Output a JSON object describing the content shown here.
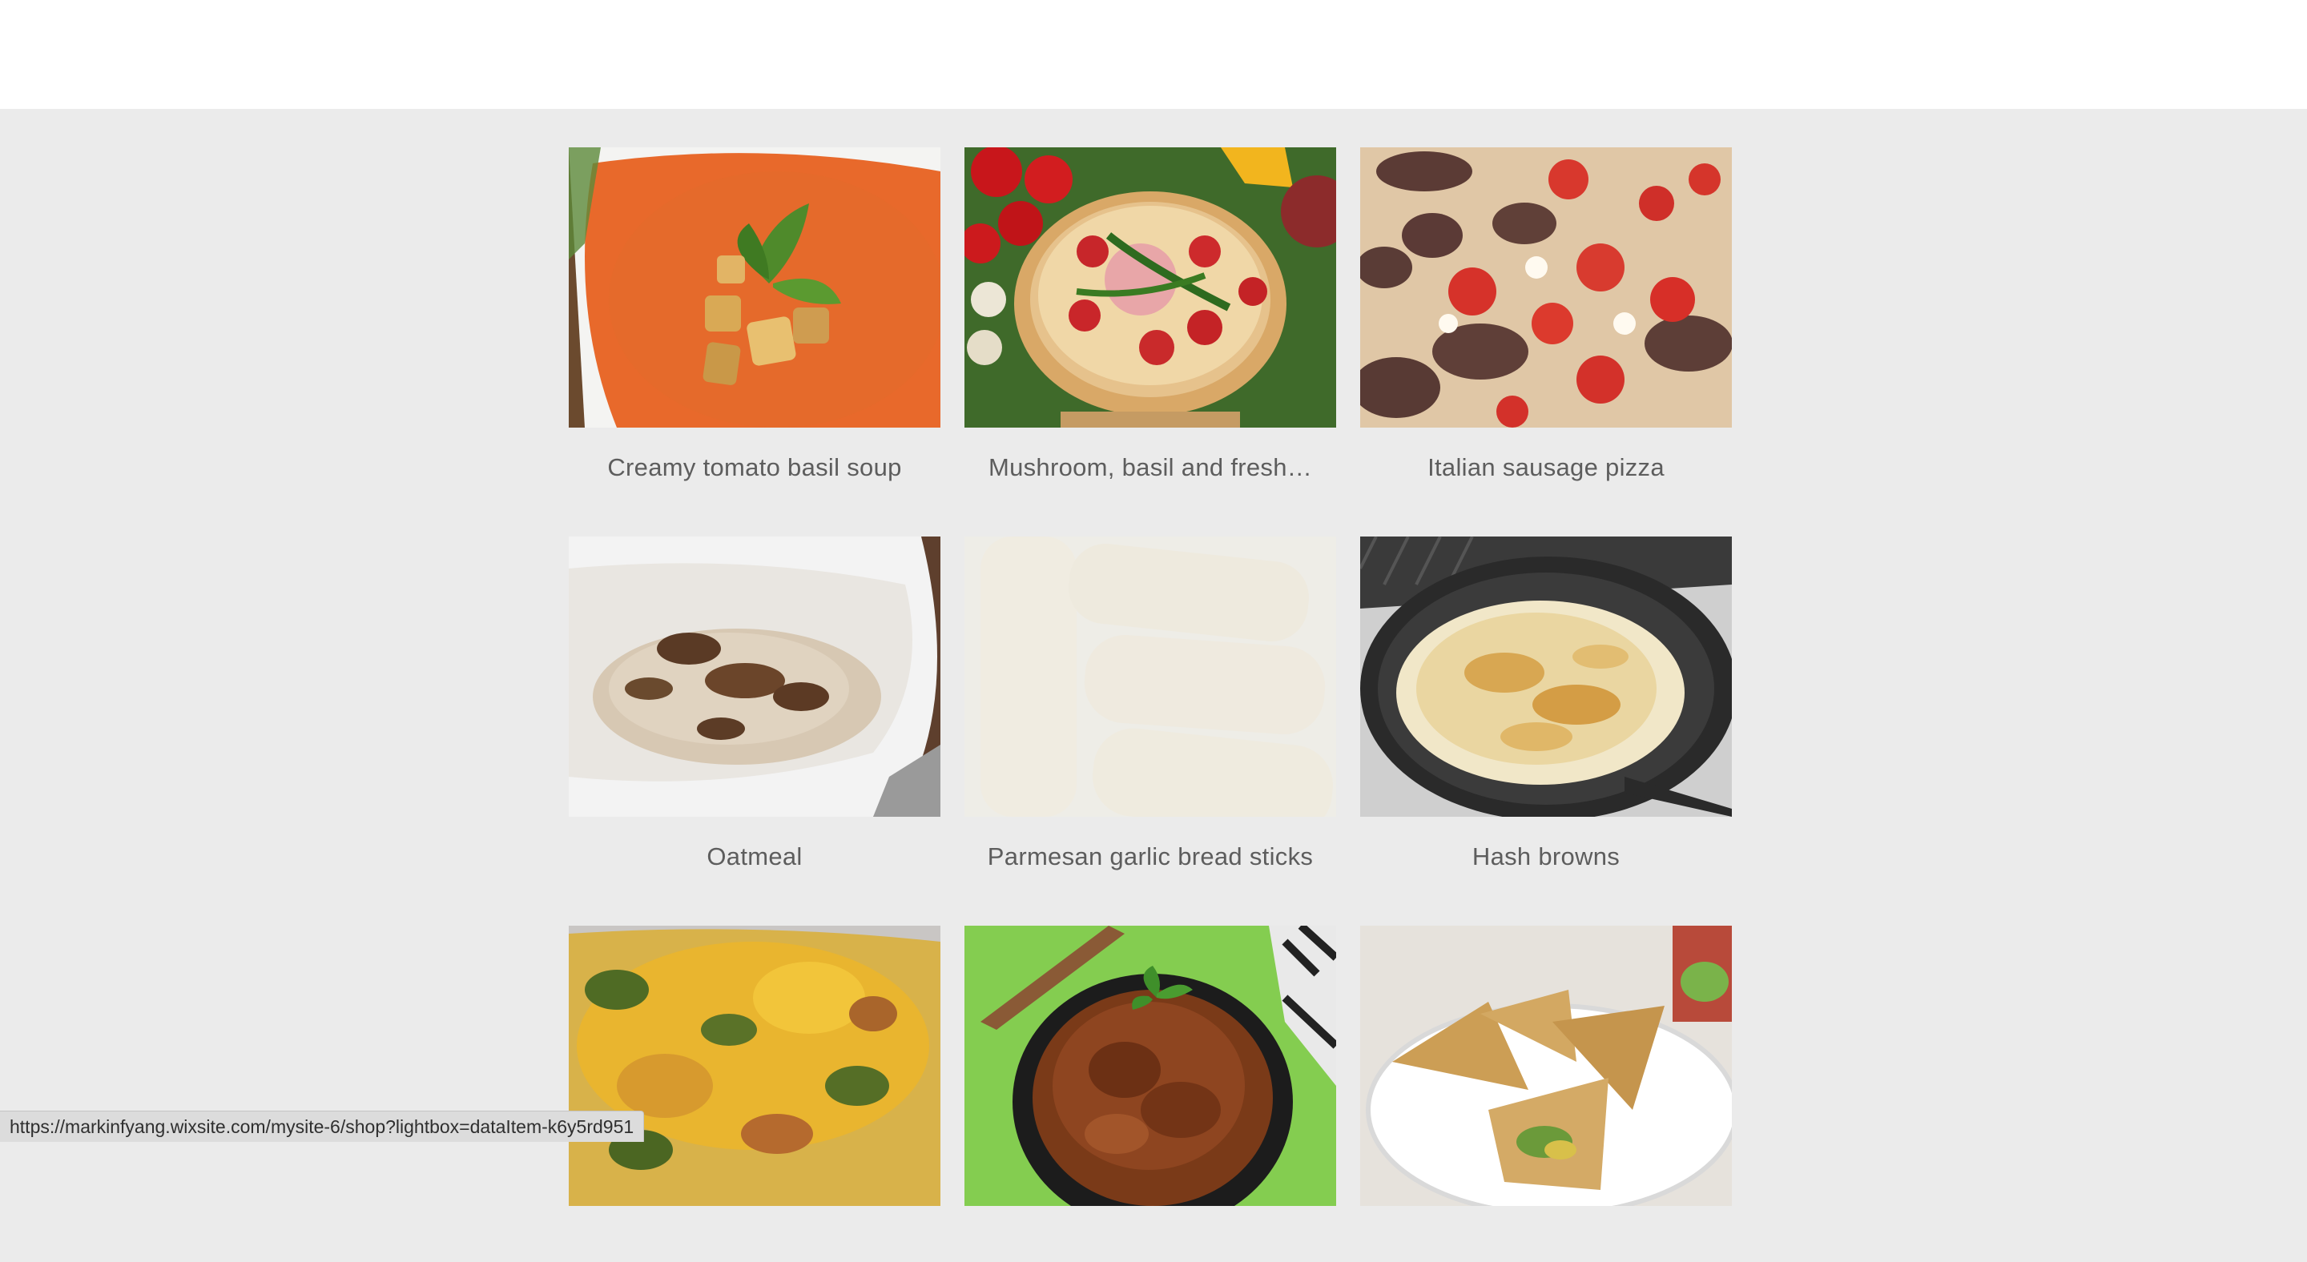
{
  "gallery": {
    "items": [
      {
        "title": "Creamy tomato basil soup",
        "image": "tomato-soup-photo"
      },
      {
        "title": "Mushroom, basil and fresh…",
        "image": "pizza-photo"
      },
      {
        "title": "Italian sausage pizza",
        "image": "sausage-pizza-photo"
      },
      {
        "title": "Oatmeal",
        "image": "oatmeal-photo"
      },
      {
        "title": "Parmesan garlic bread sticks",
        "image": "bread-sticks-photo"
      },
      {
        "title": "Hash browns",
        "image": "hash-browns-photo"
      },
      {
        "title": "",
        "image": "egg-casserole-photo"
      },
      {
        "title": "",
        "image": "curry-photo"
      },
      {
        "title": "",
        "image": "samosa-photo"
      }
    ]
  },
  "status_bar": {
    "url": "https://markinfyang.wixsite.com/mysite-6/shop?lightbox=dataItem-k6y5rd951"
  }
}
